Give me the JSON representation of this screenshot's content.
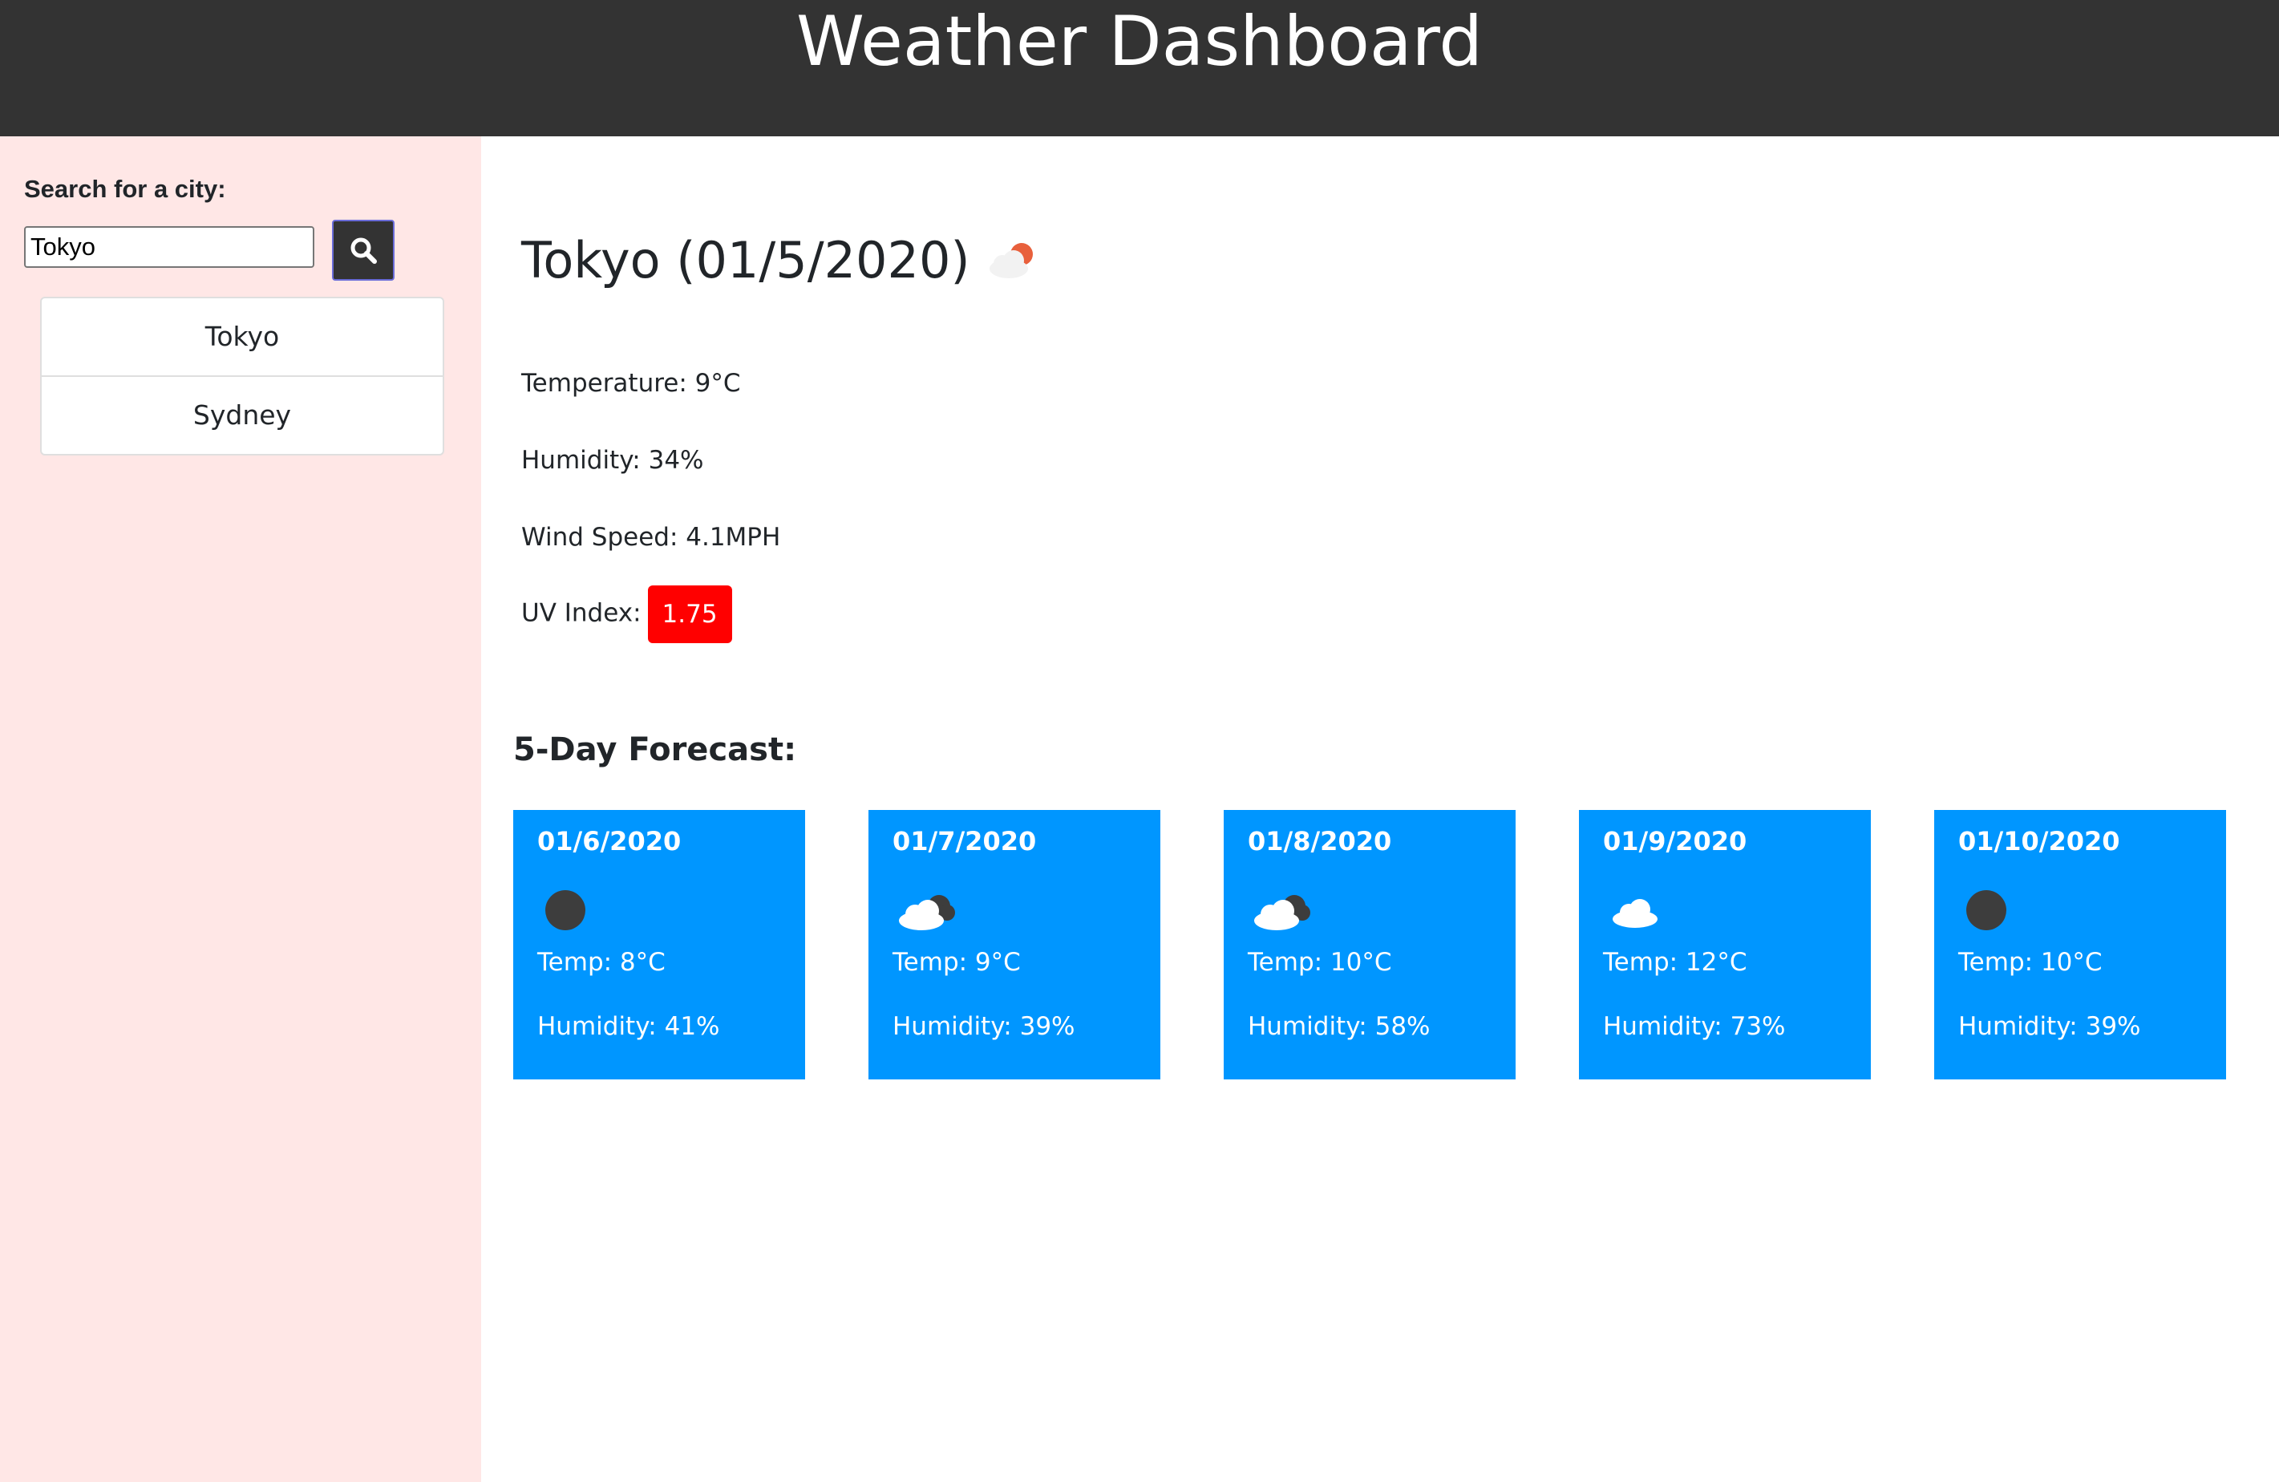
{
  "header": {
    "title": "Weather Dashboard"
  },
  "sidebar": {
    "search_label": "Search for a city:",
    "search_value": "Tokyo",
    "history": [
      {
        "label": "Tokyo"
      },
      {
        "label": "Sydney"
      }
    ]
  },
  "current": {
    "title": "Tokyo (01/5/2020)",
    "icon": "cloud-sun-icon",
    "temperature": "Temperature: 9°C",
    "humidity": "Humidity: 34%",
    "wind": "Wind Speed: 4.1MPH",
    "uv_label": "UV Index:",
    "uv_value": "1.75"
  },
  "forecast": {
    "heading": "5-Day Forecast:",
    "days": [
      {
        "date": "01/6/2020",
        "icon": "moon-icon",
        "temp": "Temp: 8°C",
        "humidity": "Humidity: 41%"
      },
      {
        "date": "01/7/2020",
        "icon": "cloud-icon",
        "temp": "Temp: 9°C",
        "humidity": "Humidity: 39%"
      },
      {
        "date": "01/8/2020",
        "icon": "cloud-icon",
        "temp": "Temp: 10°C",
        "humidity": "Humidity: 58%"
      },
      {
        "date": "01/9/2020",
        "icon": "cloud-icon",
        "temp": "Temp: 12°C",
        "humidity": "Humidity: 73%"
      },
      {
        "date": "01/10/2020",
        "icon": "moon-icon",
        "temp": "Temp: 10°C",
        "humidity": "Humidity: 39%"
      }
    ]
  },
  "colors": {
    "header_bg": "#333333",
    "sidebar_bg": "#ffe7e6",
    "card_bg": "#0096ff",
    "uv_bg": "#ff0000"
  }
}
